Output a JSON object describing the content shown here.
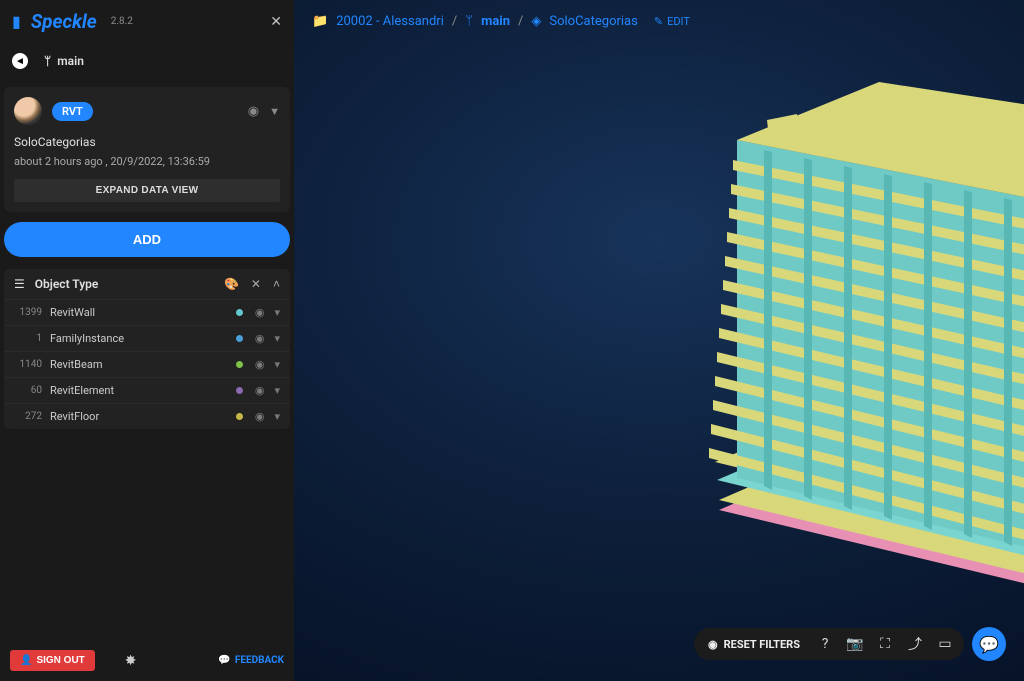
{
  "header": {
    "logo": "Speckle",
    "version": "2.8.2"
  },
  "branch": {
    "icon_label": "main"
  },
  "commit": {
    "chip": "RVT",
    "title": "SoloCategorias",
    "timestamp": "about 2 hours ago , 20/9/2022, 13:36:59",
    "expand_label": "EXPAND DATA VIEW"
  },
  "add_label": "ADD",
  "filter": {
    "title": "Object Type",
    "rows": [
      {
        "count": "1399",
        "name": "RevitWall",
        "color": "#63c8d0"
      },
      {
        "count": "1",
        "name": "FamilyInstance",
        "color": "#4a9fd8"
      },
      {
        "count": "1140",
        "name": "RevitBeam",
        "color": "#7fc24a"
      },
      {
        "count": "60",
        "name": "RevitElement",
        "color": "#8a6ab0"
      },
      {
        "count": "272",
        "name": "RevitFloor",
        "color": "#c7b84a"
      }
    ]
  },
  "bottom": {
    "signout": "SIGN OUT",
    "feedback": "FEEDBACK"
  },
  "breadcrumb": {
    "project": "20002 - Alessandri",
    "branch": "main",
    "commit": "SoloCategorias",
    "edit": "EDIT"
  },
  "toolbar": {
    "reset": "RESET FILTERS"
  }
}
